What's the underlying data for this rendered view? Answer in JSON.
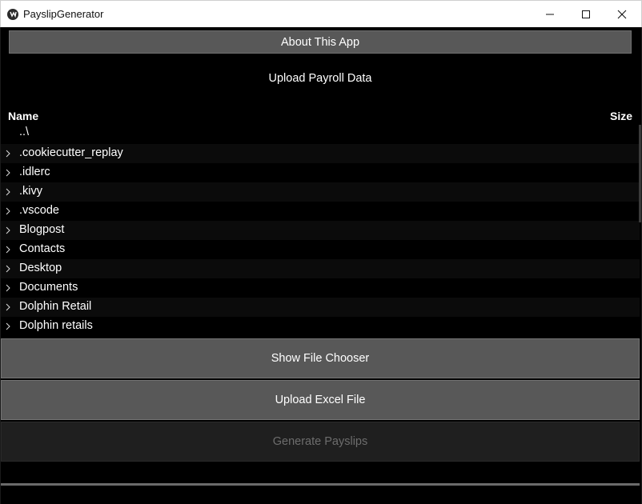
{
  "window": {
    "title": "PayslipGenerator"
  },
  "about_button": "About This App",
  "upload_label": "Upload Payroll Data",
  "file_chooser": {
    "columns": {
      "name": "Name",
      "size": "Size"
    },
    "parent_entry": "..\\",
    "items": [
      {
        "name": ".cookiecutter_replay",
        "icon": "chevron-right-icon"
      },
      {
        "name": ".idlerc",
        "icon": "chevron-right-icon"
      },
      {
        "name": ".kivy",
        "icon": "chevron-right-icon"
      },
      {
        "name": ".vscode",
        "icon": "chevron-right-icon"
      },
      {
        "name": "Blogpost",
        "icon": "chevron-right-icon"
      },
      {
        "name": "Contacts",
        "icon": "chevron-right-icon"
      },
      {
        "name": "Desktop",
        "icon": "chevron-right-icon"
      },
      {
        "name": "Documents",
        "icon": "chevron-right-icon"
      },
      {
        "name": "Dolphin Retail",
        "icon": "chevron-right-icon"
      },
      {
        "name": "Dolphin retails",
        "icon": "chevron-right-icon"
      }
    ]
  },
  "buttons": {
    "show_file_chooser": "Show File Chooser",
    "upload_excel": "Upload Excel File",
    "generate_payslips": "Generate Payslips"
  },
  "colors": {
    "background": "#000000",
    "button": "#585858",
    "disabled_text": "#6d6d6d"
  }
}
